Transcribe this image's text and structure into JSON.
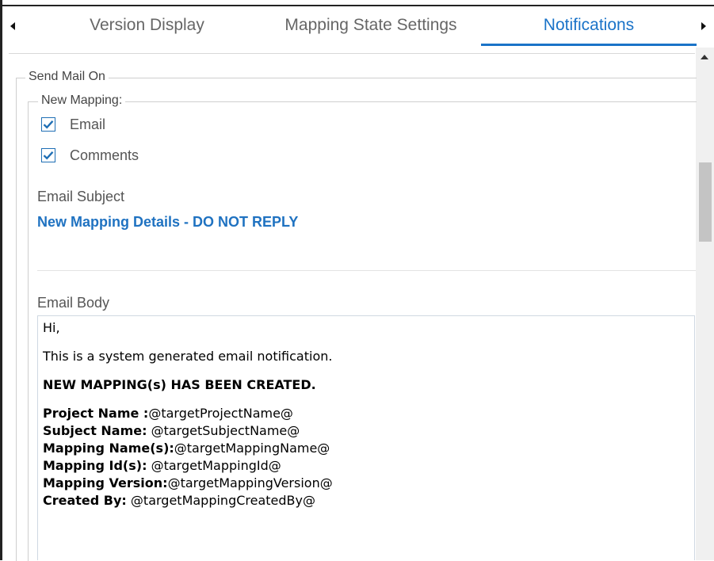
{
  "tabs": [
    {
      "label": "Version Display"
    },
    {
      "label": "Mapping State Settings"
    },
    {
      "label": "Notifications",
      "active": true
    }
  ],
  "send_mail_on": {
    "legend": "Send Mail On",
    "new_mapping": {
      "legend": "New Mapping:",
      "options": [
        {
          "label": "Email",
          "checked": true
        },
        {
          "label": "Comments",
          "checked": true
        }
      ]
    }
  },
  "email_subject": {
    "label": "Email Subject",
    "value": "New Mapping Details - DO NOT REPLY"
  },
  "email_body": {
    "label": "Email Body",
    "greeting": "Hi,",
    "intro": "This is a system generated email notification.",
    "headline": "NEW MAPPING(s) HAS BEEN CREATED.",
    "fields": [
      {
        "key": "Project Name :",
        "value": "@targetProjectName@"
      },
      {
        "key": "Subject Name:",
        "value": " @targetSubjectName@"
      },
      {
        "key": "Mapping Name(s):",
        "value": "@targetMappingName@"
      },
      {
        "key": "Mapping Id(s):",
        "value": " @targetMappingId@"
      },
      {
        "key": "Mapping Version:",
        "value": "@targetMappingVersion@"
      },
      {
        "key": "Created By:",
        "value": " @targetMappingCreatedBy@"
      }
    ]
  },
  "colors": {
    "accent": "#1a73c8",
    "subject_text": "#1f72c1",
    "checkbox": "#1f6fb5"
  },
  "icons": {
    "tab_scroll_left": "triangle-left",
    "tab_scroll_right": "triangle-right",
    "scroll_up": "triangle-up",
    "checkbox_checked": "checkmark"
  }
}
